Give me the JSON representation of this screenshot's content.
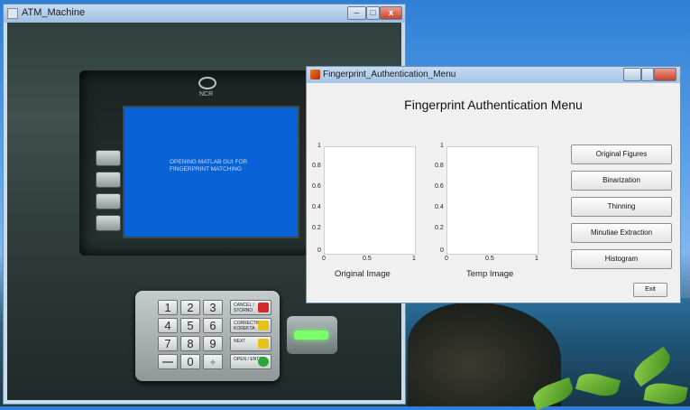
{
  "atm_window": {
    "title": "ATM_Machine",
    "controls": {
      "minimize": "–",
      "maximize": "□",
      "close": "x"
    },
    "brand": "NCR",
    "screen_message": "OPENING MATLAB GUI FOR FINGERPRINT MATCHING",
    "keypad": {
      "keys": [
        "1",
        "2",
        "3",
        "4",
        "5",
        "6",
        "7",
        "8",
        "9",
        "",
        "0",
        ""
      ],
      "function_keys": [
        {
          "label": "CANCEL / STORNO",
          "icon": "x-icon",
          "color": "#d62a2a"
        },
        {
          "label": "CORRECTION / KOREKTA",
          "icon": "chevron-left-icon",
          "color": "#e8c21a"
        },
        {
          "label": "NEXT",
          "icon": "chevron-right-icon",
          "color": "#e8c21a"
        },
        {
          "label": "OPEN / ENTER",
          "icon": "circle-icon",
          "color": "#2aa63a"
        }
      ]
    }
  },
  "matlab_window": {
    "title": "Fingerprint_Authentication_Menu",
    "heading": "Fingerprint Authentication Menu",
    "axes": [
      {
        "label": "Original Image",
        "yticks": [
          "1",
          "0.8",
          "0.6",
          "0.4",
          "0.2",
          "0"
        ],
        "xticks": [
          "0",
          "0.5",
          "1"
        ]
      },
      {
        "label": "Temp Image",
        "yticks": [
          "1",
          "0.8",
          "0.6",
          "0.4",
          "0.2",
          "0"
        ],
        "xticks": [
          "0",
          "0.5",
          "1"
        ]
      }
    ],
    "buttons": [
      "Original Figures",
      "Binarization",
      "Thinning",
      "Minutiae Extraction",
      "Histogram"
    ],
    "exit_label": "Exit"
  }
}
